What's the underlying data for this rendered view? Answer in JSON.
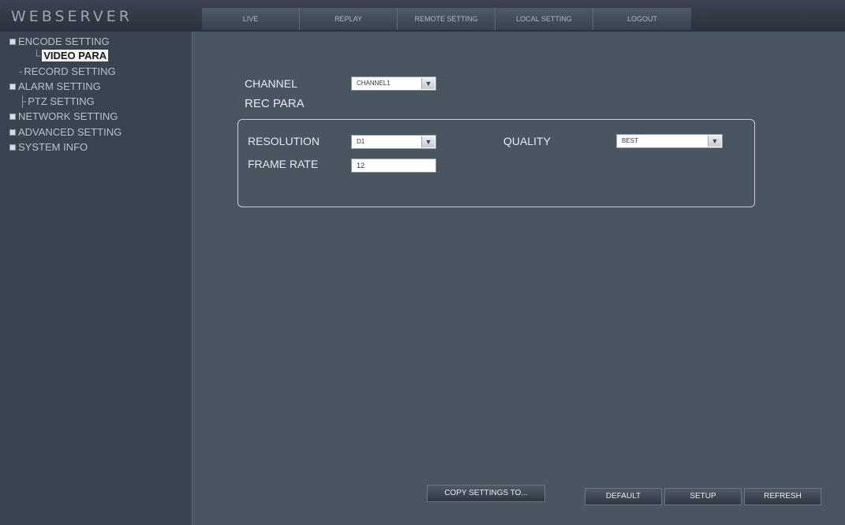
{
  "header": {
    "logo": "WEBSERVER",
    "nav": [
      "LIVE",
      "REPLAY",
      "REMOTE SETTING",
      "LOCAL SETTING",
      "LOGOUT"
    ]
  },
  "sidebar": {
    "items": [
      {
        "label": "ENCODE SETTING"
      },
      {
        "label": "VIDEO PARA"
      },
      {
        "label": "RECORD SETTING"
      },
      {
        "label": "ALARM SETTING"
      },
      {
        "label": "PTZ SETTING"
      },
      {
        "label": "NETWORK SETTING"
      },
      {
        "label": "ADVANCED SETTING"
      },
      {
        "label": "SYSTEM INFO"
      }
    ]
  },
  "main": {
    "channel_label": "CHANNEL",
    "channel_value": "CHANNEL1",
    "rec_para_label": "REC PARA",
    "resolution_label": "RESOLUTION",
    "resolution_value": "D1",
    "quality_label": "QUALITY",
    "quality_value": "BEST",
    "frame_rate_label": "FRAME RATE",
    "frame_rate_value": "12"
  },
  "buttons": {
    "copy": "COPY SETTINGS TO...",
    "default": "DEFAULT",
    "setup": "SETUP",
    "refresh": "REFRESH"
  },
  "icons": {
    "dropdown": "chevron-down-icon",
    "tree_expand": "tree-expand-icon"
  }
}
